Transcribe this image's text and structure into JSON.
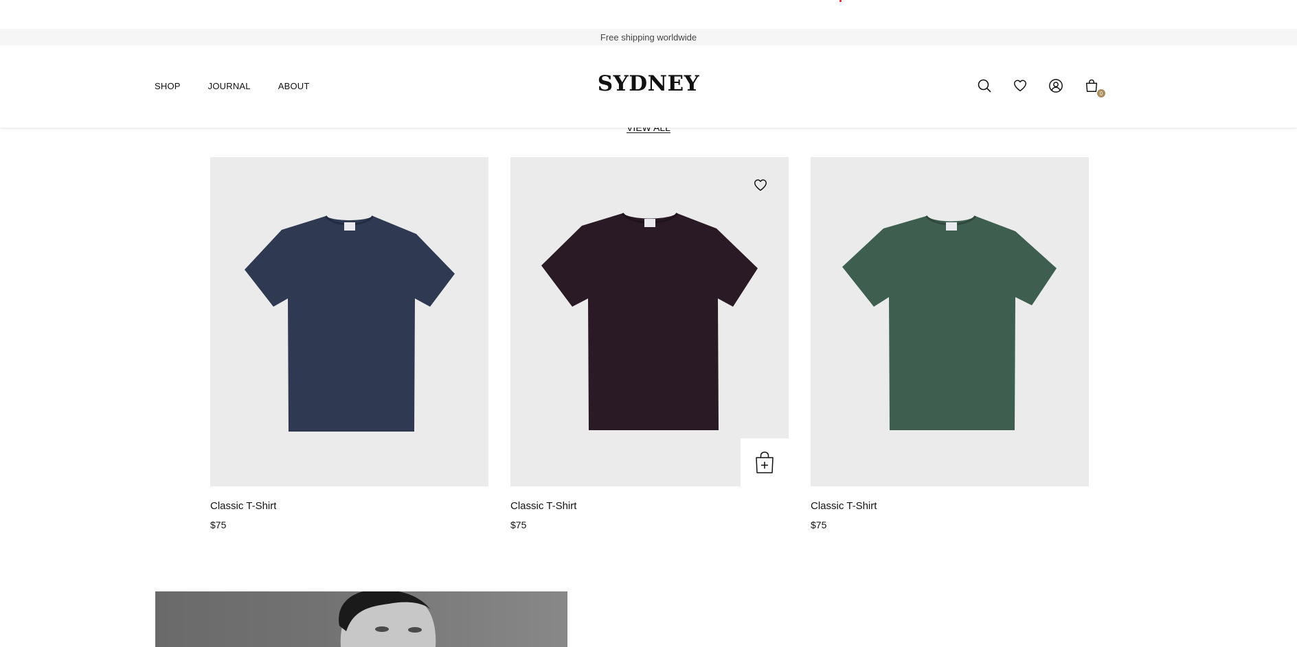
{
  "announcement": {
    "text": "Free shipping worldwide"
  },
  "header": {
    "brand": "SYDNEY",
    "nav": [
      {
        "label": "SHOP"
      },
      {
        "label": "JOURNAL"
      },
      {
        "label": "ABOUT"
      }
    ],
    "icons": [
      "search-icon",
      "heart-icon",
      "account-icon",
      "cart-icon"
    ],
    "cart_count": "0",
    "accent_color": "#a98d5a"
  },
  "section": {
    "view_all": "VIEW ALL"
  },
  "products": [
    {
      "name": "Classic T-Shirt",
      "price": "$75",
      "color": "#2f3a52"
    },
    {
      "name": "Classic T-Shirt",
      "price": "$75",
      "color": "#2a1a26"
    },
    {
      "name": "Classic T-Shirt",
      "price": "$75",
      "color": "#3e5f4f"
    }
  ]
}
